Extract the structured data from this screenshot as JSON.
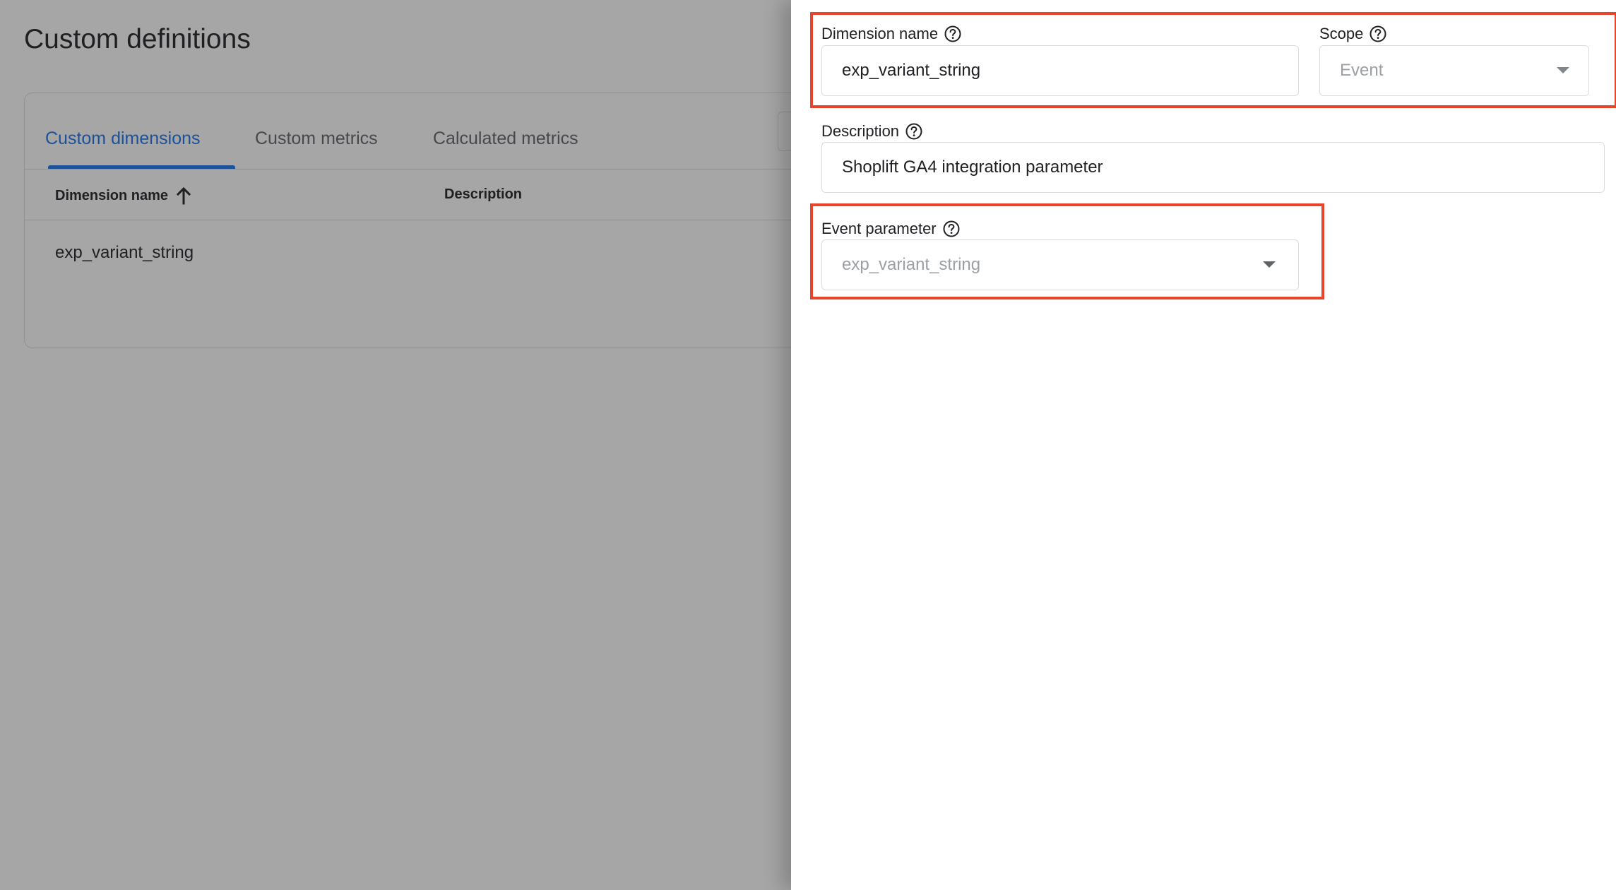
{
  "page": {
    "title": "Custom definitions"
  },
  "tabs": [
    {
      "label": "Custom dimensions",
      "active": true
    },
    {
      "label": "Custom metrics",
      "active": false
    },
    {
      "label": "Calculated metrics",
      "active": false
    }
  ],
  "table": {
    "columns": [
      "Dimension name",
      "Description"
    ],
    "sort_icon": "arrow-upward-icon",
    "rows": [
      {
        "dimension_name": "exp_variant_string",
        "description": ""
      }
    ]
  },
  "panel": {
    "dimension_name": {
      "label": "Dimension name",
      "value": "exp_variant_string",
      "help_icon": "help-circle-icon"
    },
    "scope": {
      "label": "Scope",
      "value": "Event",
      "help_icon": "help-circle-icon",
      "disabled": true
    },
    "description": {
      "label": "Description",
      "value": "Shoplift GA4 integration parameter",
      "help_icon": "help-circle-icon"
    },
    "event_parameter": {
      "label": "Event parameter",
      "value": "exp_variant_string",
      "help_icon": "help-circle-icon",
      "disabled": true
    }
  },
  "colors": {
    "accent": "#1a73e8",
    "highlight": "#e8442d",
    "scrim": "rgba(32,33,36,0.40)",
    "disabled_text": "#9aa0a6"
  }
}
